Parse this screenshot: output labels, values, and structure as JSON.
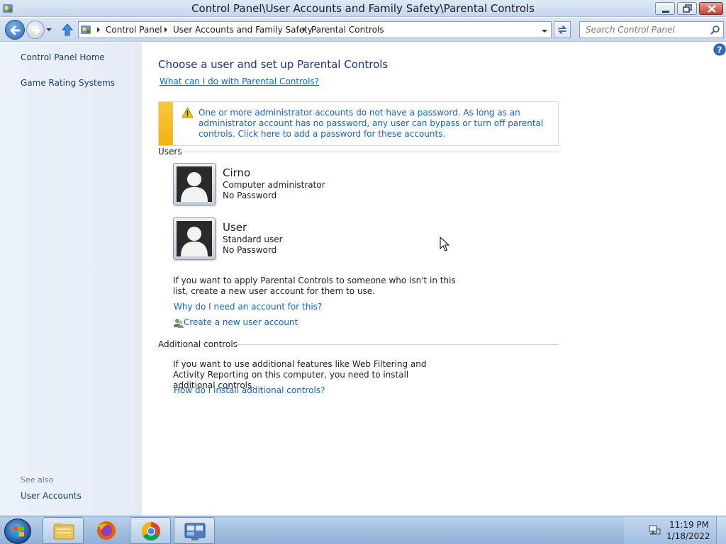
{
  "window": {
    "title": "Control Panel\\User Accounts and Family Safety\\Parental Controls"
  },
  "navbar": {
    "breadcrumbs": [
      "Control Panel",
      "User Accounts and Family Safety",
      "Parental Controls"
    ],
    "search_placeholder": "Search Control Panel"
  },
  "sidebar": {
    "items": [
      {
        "label": "Control Panel Home"
      },
      {
        "label": "Game Rating Systems"
      }
    ],
    "see_also_label": "See also",
    "see_also_items": [
      {
        "label": "User Accounts"
      }
    ]
  },
  "main": {
    "title": "Choose a user and set up Parental Controls",
    "info_link": "What can I do with Parental Controls?",
    "warning": {
      "text": "One or more administrator accounts do not have a password. As long as an administrator account has no password, any user can bypass or turn off parental controls. Click here to add a password for these accounts."
    },
    "users_section_label": "Users",
    "users": [
      {
        "name": "Cirno",
        "role": "Computer administrator",
        "password_status": "No Password"
      },
      {
        "name": "User",
        "role": "Standard user",
        "password_status": "No Password"
      }
    ],
    "add_account_text": "If you want to apply Parental Controls to someone who isn't in this list, create a new user account for them to use.",
    "why_account_link": "Why do I need an account for this?",
    "create_account_link": "Create a new user account",
    "additional_section_label": "Additional controls",
    "additional_text": "If you want to use additional features like Web Filtering and Activity Reporting on this computer, you need to install additional controls.",
    "install_link": "How do I install additional controls?"
  },
  "taskbar": {
    "pinned": [
      "start-orb-icon",
      "file-explorer-icon",
      "firefox-icon",
      "chrome-icon",
      "control-panel-icon"
    ],
    "clock_time": "11:19 PM",
    "clock_date": "1/18/2022"
  },
  "colors": {
    "link": "#1565b8",
    "title": "#1e3287",
    "warning_stripe": "#f2b311",
    "sidebar_bg": "#e3ebf6"
  }
}
